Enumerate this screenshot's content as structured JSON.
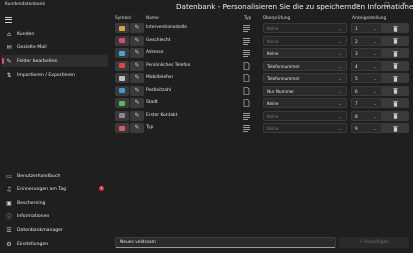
{
  "app": {
    "title": "Kundendatenbank"
  },
  "window_controls": {
    "minimize": "—",
    "maximize": "▢",
    "close": "✕"
  },
  "sidebar": {
    "top_items": [
      {
        "label": "Kunden",
        "icon": "home-icon",
        "active": false
      },
      {
        "label": "Gezielte Mail",
        "icon": "mail-icon",
        "active": false
      },
      {
        "label": "Felder bearbeiten",
        "icon": "pencil-icon",
        "active": true
      },
      {
        "label": "Importieren / Exportieren",
        "icon": "import-export-icon",
        "active": false
      }
    ],
    "bottom_items": [
      {
        "label": "Benutzerhandbuch",
        "icon": "book-icon"
      },
      {
        "label": "Erinnerungen am Tag",
        "icon": "bell-icon",
        "badge": "1"
      },
      {
        "label": "Bescherning",
        "icon": "gift-icon"
      },
      {
        "label": "Informationen",
        "icon": "info-icon"
      },
      {
        "label": "Datenbankmanager",
        "icon": "database-icon"
      },
      {
        "label": "Einstellungen",
        "icon": "gear-icon"
      }
    ]
  },
  "main": {
    "title": "Datenbank - Personalisieren Sie die zu speichernden Informationen",
    "columns": {
      "symbol": "Symbol",
      "name": "Name",
      "type": "Typ",
      "check": "Überprüfung",
      "order": "Anzeigestellung"
    },
    "rows": [
      {
        "name": "Interventionsstelle",
        "symbol_color": "#e0a23a",
        "type": "text",
        "check": "Keine",
        "check_enabled": false,
        "position": "1"
      },
      {
        "name": "Geschlecht",
        "symbol_color": "#d64b7a",
        "type": "text",
        "check": "Keine",
        "check_enabled": false,
        "position": "2"
      },
      {
        "name": "Adresse",
        "symbol_color": "#3fa7e0",
        "type": "text",
        "check": "Keine",
        "check_enabled": true,
        "position": "3"
      },
      {
        "name": "Persönliches Telefon",
        "symbol_color": "#e04848",
        "type": "doc",
        "check": "Telefonnummer",
        "check_enabled": true,
        "position": "4"
      },
      {
        "name": "Mobiltelefon",
        "symbol_color": "#c0c0c0",
        "type": "doc",
        "check": "Telefonnummer",
        "check_enabled": true,
        "position": "5"
      },
      {
        "name": "Postleitzahl",
        "symbol_color": "#3aa0d8",
        "type": "doc",
        "check": "Nur Nummer",
        "check_enabled": true,
        "position": "6"
      },
      {
        "name": "Stadt",
        "symbol_color": "#5cb85c",
        "type": "doc",
        "check": "Keine",
        "check_enabled": true,
        "position": "7"
      },
      {
        "name": "Erster Kontakt",
        "symbol_color": "#8a8a8a",
        "type": "text",
        "check": "Keine",
        "check_enabled": false,
        "position": "8"
      },
      {
        "name": "Typ",
        "symbol_color": "#e05a5a",
        "type": "text",
        "check": "Keine",
        "check_enabled": false,
        "position": "9"
      }
    ],
    "new_field_value": "Neues veldraam",
    "add_button": "+  Hinzufügen"
  }
}
